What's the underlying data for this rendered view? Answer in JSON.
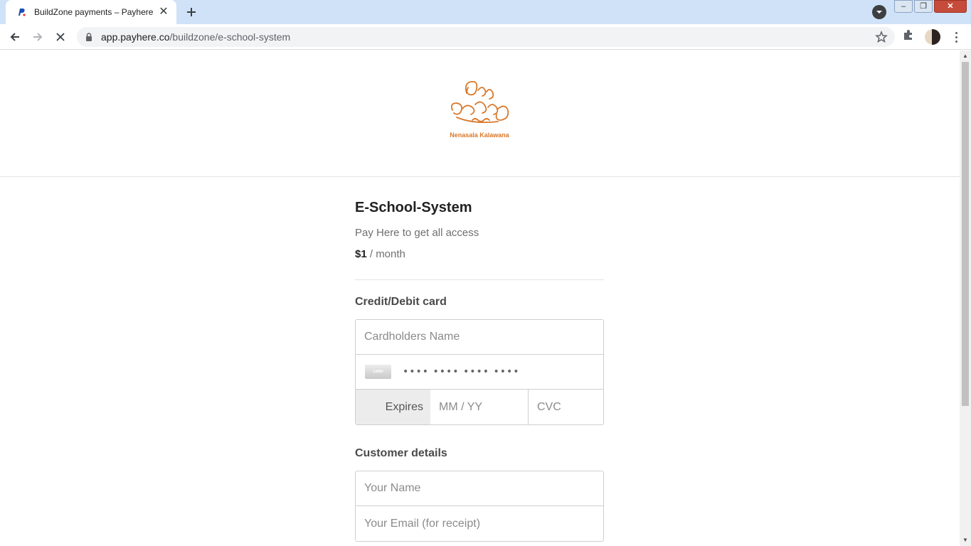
{
  "browser": {
    "tab_title": "BuildZone payments – Payhere",
    "url_host": "app.payhere.co",
    "url_path": "/buildzone/e-school-system",
    "window_buttons": {
      "minimize": "‒",
      "restore": "❐",
      "close": "✕"
    }
  },
  "header": {
    "logo_text": "Nenasala Kalawana"
  },
  "product": {
    "title": "E-School-System",
    "description": "Pay Here to get all access",
    "price_amount": "$1",
    "price_period": " / month"
  },
  "card_section": {
    "title": "Credit/Debit card",
    "cardholder_placeholder": "Cardholders Name",
    "card_icon_text": "CARD",
    "card_number_placeholder": "•••• •••• •••• ••••",
    "expires_label": "Expires",
    "expiry_placeholder": "MM / YY",
    "cvc_placeholder": "CVC"
  },
  "customer_section": {
    "title": "Customer details",
    "name_placeholder": "Your Name",
    "email_placeholder": "Your Email (for receipt)"
  },
  "colors": {
    "brand_orange": "#d9782a",
    "tabbar": "#cfe2f7"
  }
}
